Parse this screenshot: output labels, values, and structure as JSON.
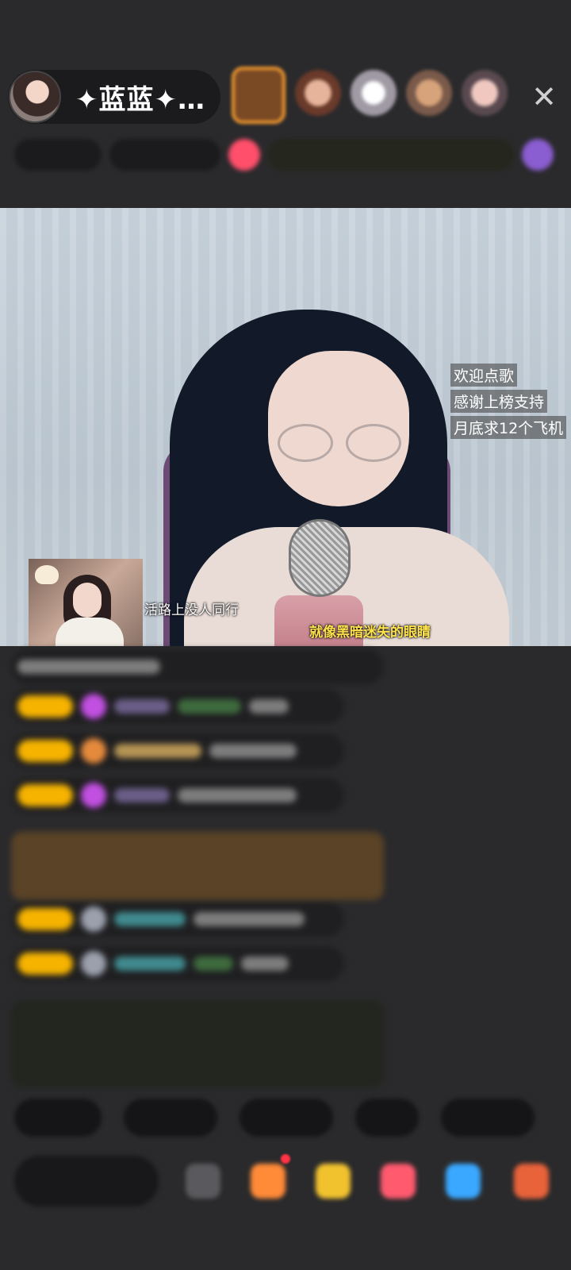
{
  "header": {
    "host_name": "✦蓝蓝✦…",
    "close_glyph": "✕",
    "viewer_avatar_count": 5
  },
  "video": {
    "side_notes": [
      "欢迎点歌",
      "感谢上榜支持",
      "月底求12个飞机"
    ],
    "lyric_left": "活路上没人同行",
    "lyric_right": "就像黑暗迷失的眼睛"
  },
  "colors": {
    "background": "#2a2a2c",
    "badge": "#f6b300",
    "lyric_highlight": "#ffe34d"
  }
}
